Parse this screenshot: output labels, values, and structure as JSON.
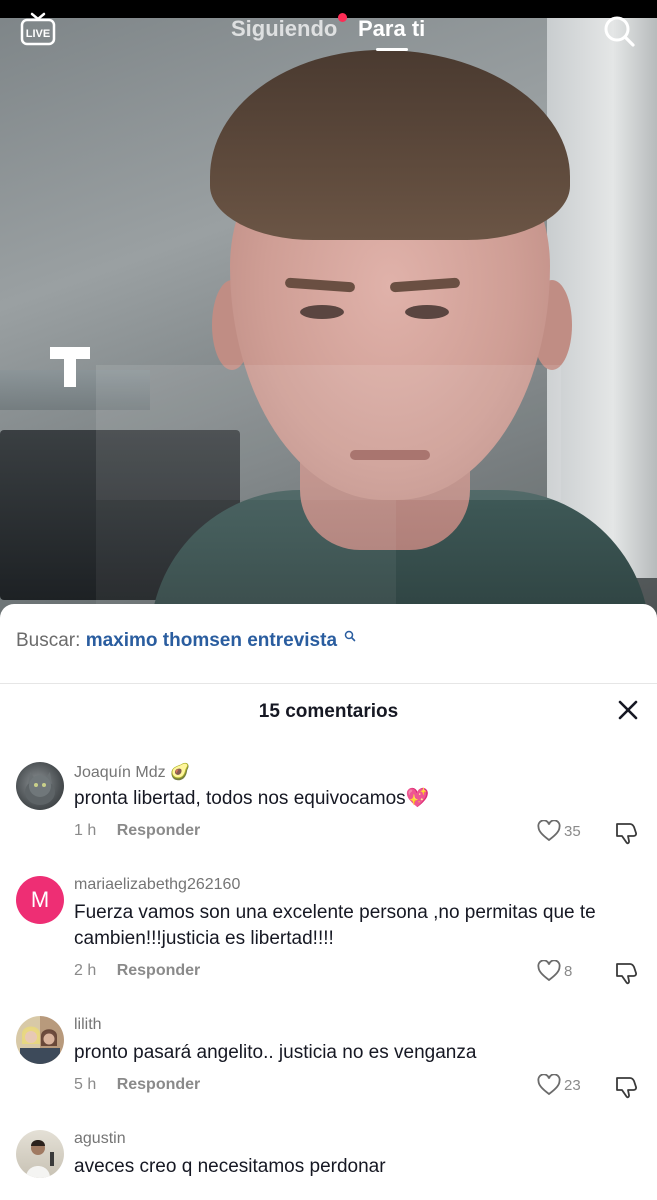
{
  "nav": {
    "tab_following": "Siguiendo",
    "tab_for_you": "Para ti",
    "live_icon": "live-tv-icon",
    "search_icon": "search-icon",
    "has_notification": true,
    "live_label": "LIVE"
  },
  "search": {
    "label": "Buscar:",
    "query": "maximo thomsen entrevista"
  },
  "comments_header": {
    "count_label": "15 comentarios",
    "close_icon": "close-icon"
  },
  "comments": [
    {
      "username": "Joaquín Mdz 🥑",
      "text": "pronta libertad, todos nos equivocamos💖",
      "time": "1 h",
      "reply": "Responder",
      "likes": "35",
      "avatar": "cat-photo"
    },
    {
      "username": "mariaelizabethg262160",
      "text": "Fuerza vamos son una excelente persona ,no permitas que te cambien!!!justicia es libertad!!!!",
      "time": "2 h",
      "reply": "Responder",
      "likes": "8",
      "avatar_letter": "M"
    },
    {
      "username": "lilith",
      "text": "pronto pasará angelito.. justicia no es venganza",
      "time": "5 h",
      "reply": "Responder",
      "likes": "23",
      "avatar": "two-people-photo"
    },
    {
      "username": "agustin",
      "text": "aveces creo q necesitamos perdonar",
      "avatar": "person-photo"
    }
  ],
  "colors": {
    "accent_red": "#fe2c55",
    "search_link": "#2a5d9f",
    "avatar_pink": "#ee2e74"
  }
}
